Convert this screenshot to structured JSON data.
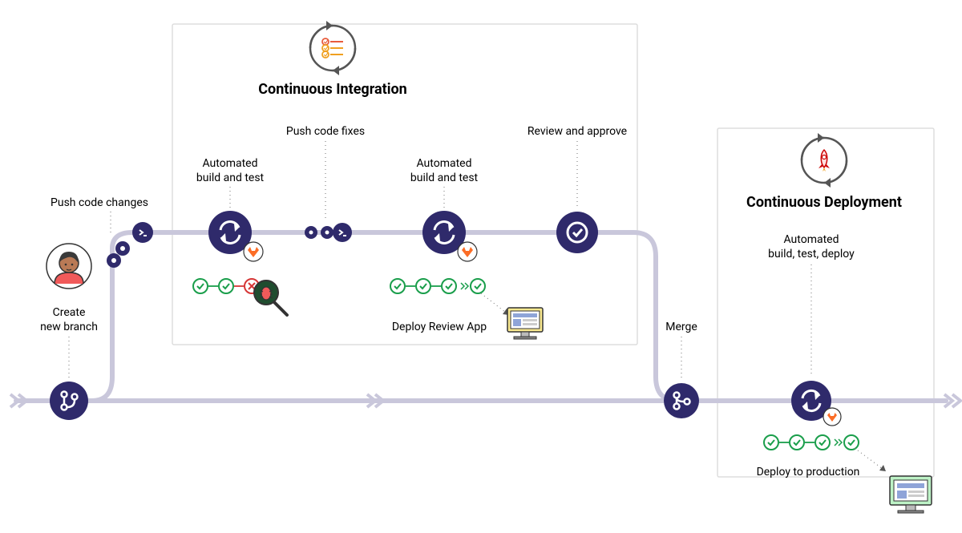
{
  "diagram": {
    "sections": {
      "ci": {
        "title": "Continuous Integration"
      },
      "cd": {
        "title": "Continuous Deployment"
      }
    },
    "steps": {
      "create_branch": "Create\nnew branch",
      "push_changes": "Push code changes",
      "build_test_1": "Automated\nbuild and test",
      "push_fixes": "Push code fixes",
      "build_test_2": "Automated\nbuild and test",
      "review_approve": "Review and approve",
      "deploy_review": "Deploy Review App",
      "merge": "Merge",
      "build_test_deploy": "Automated\nbuild, test, deploy",
      "deploy_prod": "Deploy to production"
    },
    "pipeline_status": {
      "first_run": [
        "ok",
        "ok",
        "fail"
      ],
      "second_run": [
        "ok",
        "ok",
        "ok",
        "ok"
      ],
      "prod_run": [
        "ok",
        "ok",
        "ok",
        "ok"
      ]
    }
  }
}
